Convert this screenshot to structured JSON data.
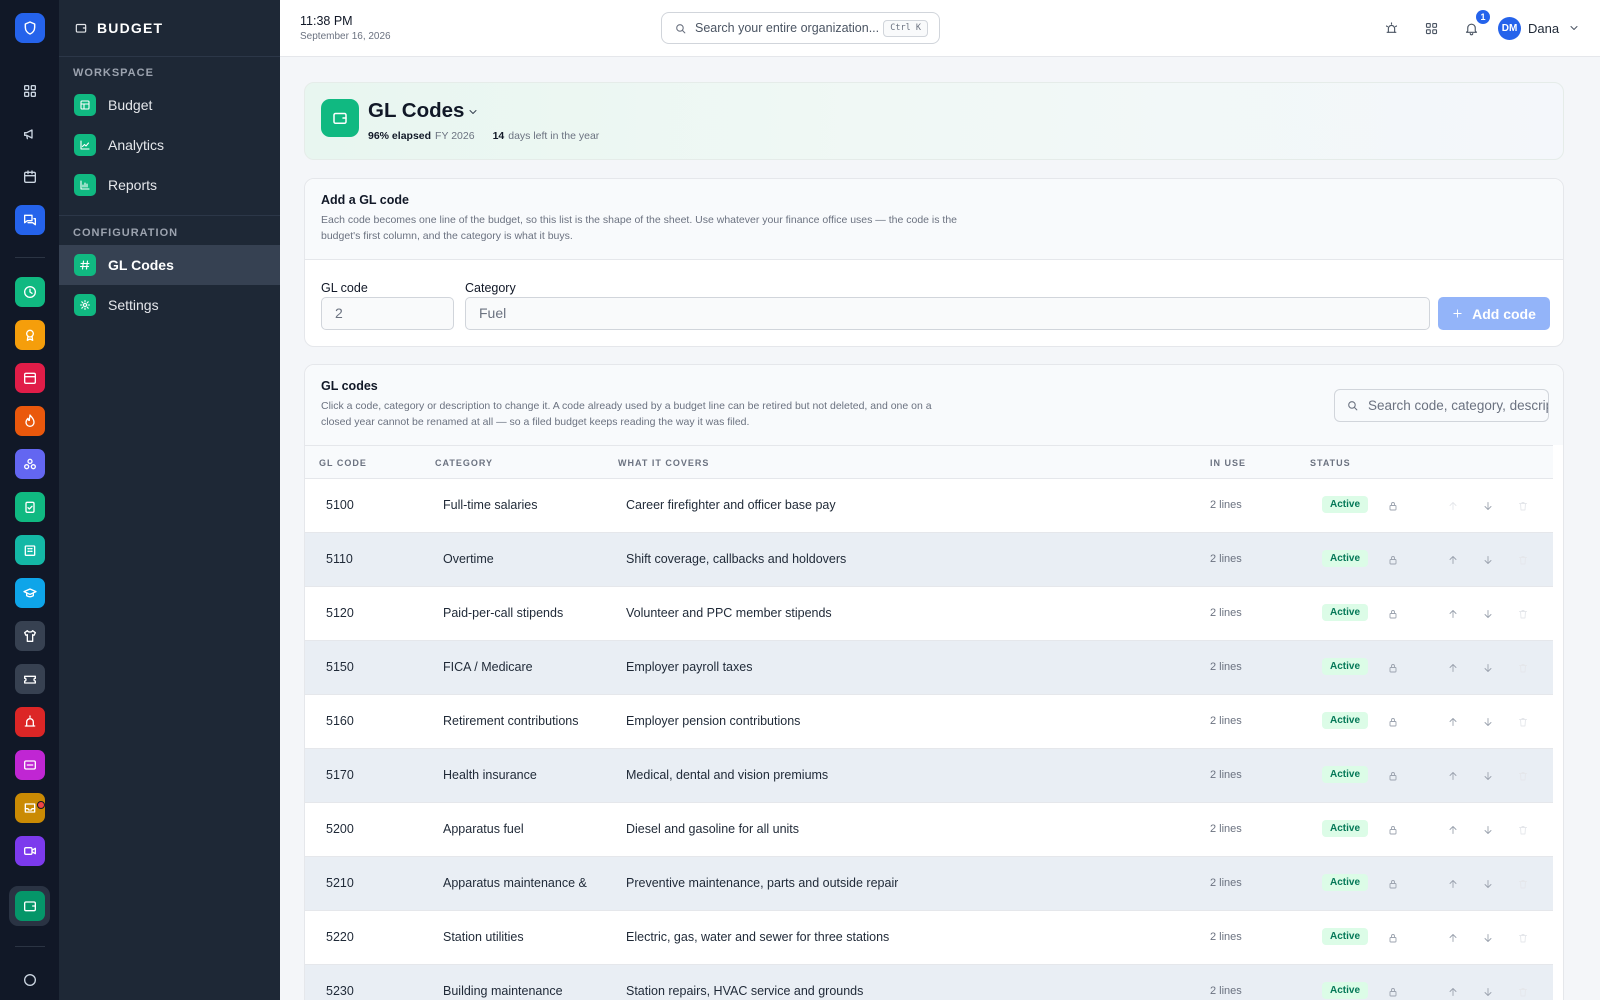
{
  "rail": {
    "colors": {
      "logo": "#2563eb",
      "items": [
        "#10b981",
        "#f59e0b",
        "#e11d48",
        "#ea580c",
        "#6366f1",
        "#10b981",
        "#14b8a6",
        "#0ea5e9",
        "#374151",
        "#374151",
        "#dc2626",
        "#c026d3",
        "#ca8a04",
        "#7c3aed",
        "#059669"
      ]
    }
  },
  "sidebar": {
    "title": "BUDGET",
    "workspace_label": "WORKSPACE",
    "configuration_label": "CONFIGURATION",
    "workspace_items": [
      {
        "label": "Budget",
        "icon": "table-icon"
      },
      {
        "label": "Analytics",
        "icon": "line-chart-icon"
      },
      {
        "label": "Reports",
        "icon": "bar-chart-icon"
      }
    ],
    "configuration_items": [
      {
        "label": "GL Codes",
        "icon": "hash-icon",
        "active": true
      },
      {
        "label": "Settings",
        "icon": "gear-icon"
      }
    ]
  },
  "topbar": {
    "time": "11:38 PM",
    "date": "September 16, 2026",
    "search_placeholder": "Search your entire organization...",
    "shortcut": "Ctrl K",
    "notification_count": "1",
    "user_initials": "DM",
    "user_name": "Dana"
  },
  "header": {
    "title": "GL Codes",
    "elapsed": "96% elapsed",
    "fiscal_year": "FY 2026",
    "days_left": "14",
    "days_left_label": "days left in the year"
  },
  "add_form": {
    "title": "Add a GL code",
    "description": "Each code becomes one line of the budget, so this list is the shape of the sheet. Use whatever your finance office uses — the code is the budget's first column, and the category is what it buys.",
    "gl_code_label": "GL code",
    "gl_code_placeholder": "2",
    "category_label": "Category",
    "category_placeholder": "Fuel",
    "add_button": "Add code"
  },
  "table": {
    "title": "GL codes",
    "description": "Click a code, category or description to change it. A code already used by a budget line can be retired but not deleted, and one on a closed year cannot be renamed at all — so a filed budget keeps reading the way it was filed.",
    "search_placeholder": "Search code, category, description",
    "columns": [
      "GL CODE",
      "CATEGORY",
      "WHAT IT COVERS",
      "IN USE",
      "STATUS"
    ],
    "rows": [
      {
        "code": "5100",
        "category": "Full-time salaries",
        "covers": "Career firefighter and officer base pay",
        "in_use": "2 lines",
        "status": "Active"
      },
      {
        "code": "5110",
        "category": "Overtime",
        "covers": "Shift coverage, callbacks and holdovers",
        "in_use": "2 lines",
        "status": "Active"
      },
      {
        "code": "5120",
        "category": "Paid-per-call stipends",
        "covers": "Volunteer and PPC member stipends",
        "in_use": "2 lines",
        "status": "Active"
      },
      {
        "code": "5150",
        "category": "FICA / Medicare",
        "covers": "Employer payroll taxes",
        "in_use": "2 lines",
        "status": "Active"
      },
      {
        "code": "5160",
        "category": "Retirement contributions",
        "covers": "Employer pension contributions",
        "in_use": "2 lines",
        "status": "Active"
      },
      {
        "code": "5170",
        "category": "Health insurance",
        "covers": "Medical, dental and vision premiums",
        "in_use": "2 lines",
        "status": "Active"
      },
      {
        "code": "5200",
        "category": "Apparatus fuel",
        "covers": "Diesel and gasoline for all units",
        "in_use": "2 lines",
        "status": "Active"
      },
      {
        "code": "5210",
        "category": "Apparatus maintenance &",
        "covers": "Preventive maintenance, parts and outside repair",
        "in_use": "2 lines",
        "status": "Active"
      },
      {
        "code": "5220",
        "category": "Station utilities",
        "covers": "Electric, gas, water and sewer for three stations",
        "in_use": "2 lines",
        "status": "Active"
      },
      {
        "code": "5230",
        "category": "Building maintenance",
        "covers": "Station repairs, HVAC service and grounds",
        "in_use": "2 lines",
        "status": "Active"
      }
    ]
  }
}
